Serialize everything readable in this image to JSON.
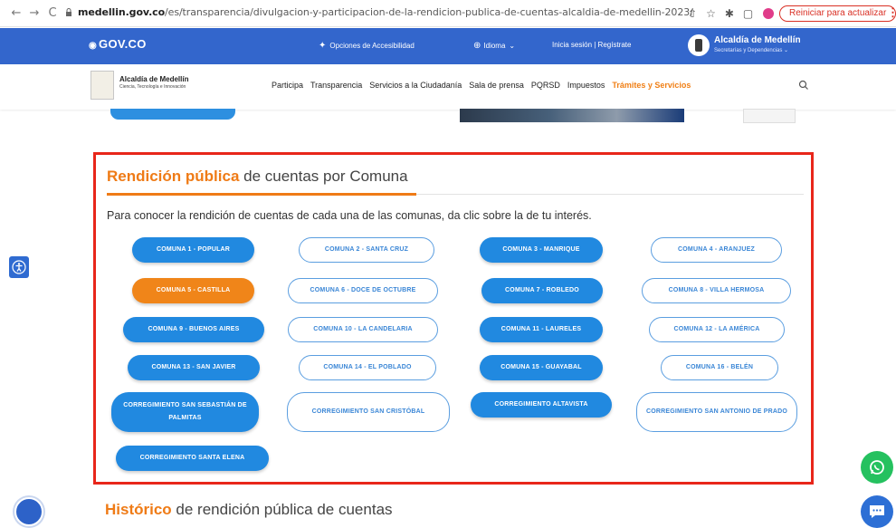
{
  "browser": {
    "url_domain": "medellin.gov.co",
    "url_path": "/es/transparencia/divulgacion-y-participacion-de-la-rendicion-publica-de-cuentas-alcaldia-de-medellin-2023/",
    "update_button": "Reiniciar para actualizar",
    "back_icon": "←",
    "forward_icon": "→",
    "reload_icon": "C"
  },
  "govbar": {
    "logo": "GOV.CO",
    "accessibility": "Opciones de Accesibilidad",
    "language": "Idioma",
    "login": "Inicia sesión  |  Regístrate",
    "org_title": "Alcaldía de Medellín",
    "org_sub": "Secretarías y Dependencias"
  },
  "mainnav": {
    "brand_title": "Alcaldía de Medellín",
    "brand_sub": "Ciencia, Tecnología e Innovación",
    "links": [
      "Participa",
      "Transparencia",
      "Servicios a la Ciudadanía",
      "Sala de prensa",
      "PQRSD",
      "Impuestos"
    ],
    "highlight_link": "Trámites y Servicios"
  },
  "panel": {
    "title_bold": "Rendición pública",
    "title_rest": " de cuentas por Comuna",
    "intro": "Para conocer la rendición de cuentas de cada una de las comunas, da clic sobre la de tu interés.",
    "buttons": [
      {
        "label": "COMUNA 1 - POPULAR",
        "style": "filled"
      },
      {
        "label": "COMUNA 2 - SANTA CRUZ",
        "style": "outline"
      },
      {
        "label": "COMUNA 3 - MANRIQUE",
        "style": "filled"
      },
      {
        "label": "COMUNA 4 - ARANJUEZ",
        "style": "outline"
      },
      {
        "label": "COMUNA 5 - CASTILLA",
        "style": "active"
      },
      {
        "label": "COMUNA 6 - DOCE DE OCTUBRE",
        "style": "outline"
      },
      {
        "label": "COMUNA 7 - ROBLEDO",
        "style": "filled"
      },
      {
        "label": "COMUNA 8 - VILLA HERMOSA",
        "style": "outline"
      },
      {
        "label": "COMUNA 9 - BUENOS AIRES",
        "style": "filled"
      },
      {
        "label": "COMUNA 10 - LA CANDELARIA",
        "style": "outline"
      },
      {
        "label": "COMUNA 11 - LAURELES",
        "style": "filled"
      },
      {
        "label": "COMUNA 12 - LA AMÉRICA",
        "style": "outline"
      },
      {
        "label": "COMUNA 13 - SAN JAVIER",
        "style": "filled"
      },
      {
        "label": "COMUNA 14 - EL POBLADO",
        "style": "outline"
      },
      {
        "label": "COMUNA 15 - GUAYABAL",
        "style": "filled"
      },
      {
        "label": "COMUNA 16 - BELÉN",
        "style": "outline"
      },
      {
        "label": "CORREGIMIENTO SAN SEBASTIÁN DE PALMITAS",
        "style": "filled"
      },
      {
        "label": "CORREGIMIENTO SAN CRISTÓBAL",
        "style": "outline"
      },
      {
        "label": "CORREGIMIENTO ALTAVISTA",
        "style": "filled"
      },
      {
        "label": "CORREGIMIENTO SAN ANTONIO DE PRADO",
        "style": "outline"
      },
      {
        "label": "CORREGIMIENTO SANTA ELENA",
        "style": "filled"
      }
    ]
  },
  "history": {
    "title_bold": "Histórico",
    "title_rest": " de rendición pública de cuentas"
  },
  "colors": {
    "gov_blue": "#3366cc",
    "accent_orange": "#ef7b16",
    "button_blue": "#2189e0",
    "panel_border": "#e8261a"
  },
  "icons": [
    "lock-icon",
    "share-icon",
    "star-icon",
    "extensions-icon",
    "sidebar-icon",
    "profile-icon",
    "accessibility-icon",
    "globe-icon",
    "search-icon",
    "whatsapp-icon",
    "chat-icon",
    "chatbot-icon"
  ]
}
